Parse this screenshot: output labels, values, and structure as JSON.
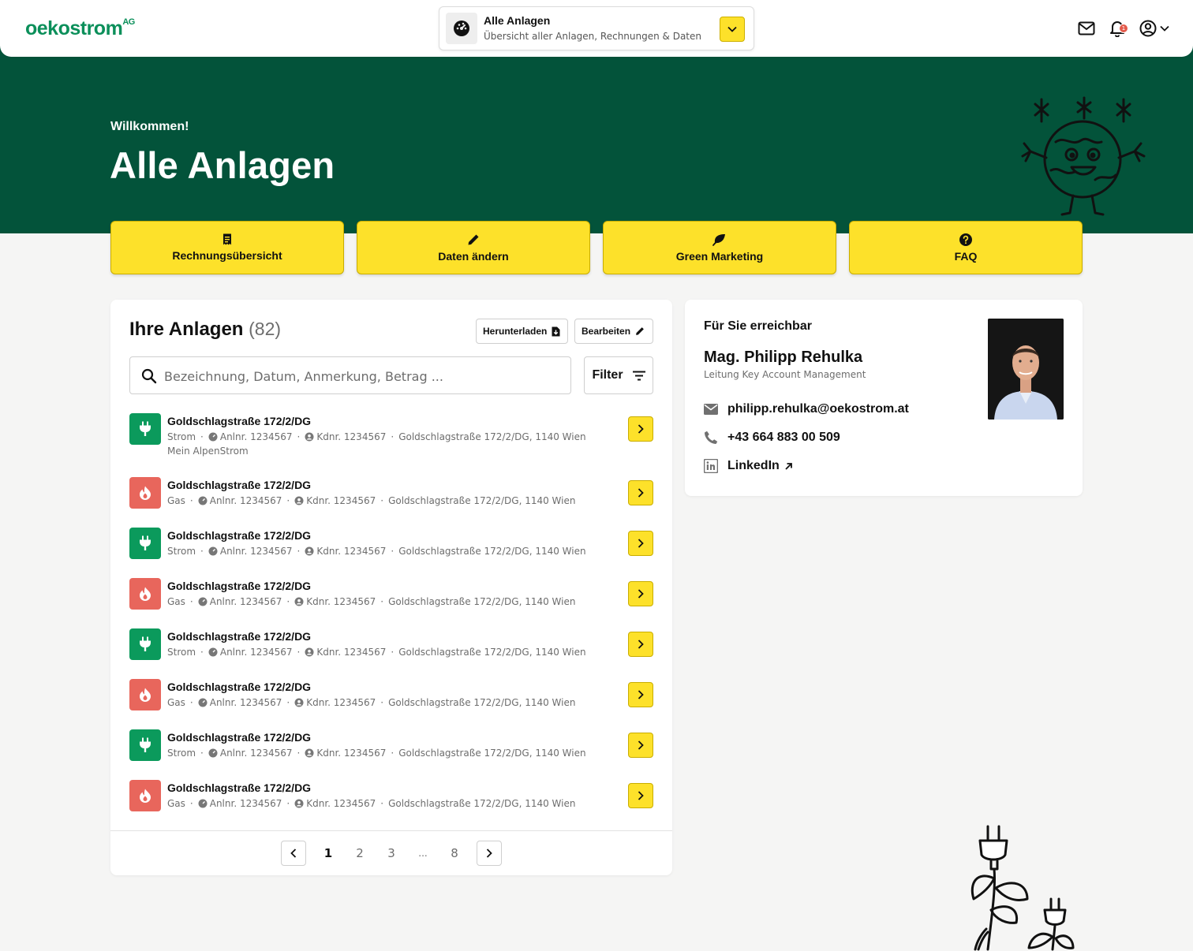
{
  "header": {
    "logo_text": "oekostrom",
    "logo_suffix": "AG",
    "switcher": {
      "title": "Alle Anlagen",
      "subtitle": "Übersicht aller Anlagen, Rechnungen & Daten"
    },
    "notification_count": "1",
    "icons": [
      "mail-icon",
      "bell-icon",
      "user-circle-icon",
      "chevron-down-icon"
    ]
  },
  "hero": {
    "welcome": "Willkommen!",
    "title": "Alle Anlagen"
  },
  "tiles": [
    {
      "label": "Rechnungsübersicht",
      "icon": "receipt-icon"
    },
    {
      "label": "Daten ändern",
      "icon": "pencil-icon"
    },
    {
      "label": "Green Marketing",
      "icon": "leaf-icon"
    },
    {
      "label": "FAQ",
      "icon": "question-icon"
    }
  ],
  "anlagen": {
    "title": "Ihre Anlagen",
    "count": "(82)",
    "download_label": "Herunterladen",
    "edit_label": "Bearbeiten",
    "search_placeholder": "Bezeichnung, Datum, Anmerkung, Betrag ...",
    "filter_label": "Filter",
    "rows": [
      {
        "type": "strom",
        "name": "Goldschlagstraße 172/2/DG",
        "kind": "Strom",
        "anlnr": "Anlnr. 1234567",
        "kdnr": "Kdnr. 1234567",
        "address": "Goldschlagstraße 172/2/DG, 1140 Wien",
        "sub": "Mein AlpenStrom"
      },
      {
        "type": "gas",
        "name": "Goldschlagstraße 172/2/DG",
        "kind": "Gas",
        "anlnr": "Anlnr. 1234567",
        "kdnr": "Kdnr. 1234567",
        "address": "Goldschlagstraße 172/2/DG, 1140 Wien"
      },
      {
        "type": "strom",
        "name": "Goldschlagstraße 172/2/DG",
        "kind": "Strom",
        "anlnr": "Anlnr. 1234567",
        "kdnr": "Kdnr. 1234567",
        "address": "Goldschlagstraße 172/2/DG, 1140 Wien"
      },
      {
        "type": "gas",
        "name": "Goldschlagstraße 172/2/DG",
        "kind": "Gas",
        "anlnr": "Anlnr. 1234567",
        "kdnr": "Kdnr. 1234567",
        "address": "Goldschlagstraße 172/2/DG, 1140 Wien"
      },
      {
        "type": "strom",
        "name": "Goldschlagstraße 172/2/DG",
        "kind": "Strom",
        "anlnr": "Anlnr. 1234567",
        "kdnr": "Kdnr. 1234567",
        "address": "Goldschlagstraße 172/2/DG, 1140 Wien"
      },
      {
        "type": "gas",
        "name": "Goldschlagstraße 172/2/DG",
        "kind": "Gas",
        "anlnr": "Anlnr. 1234567",
        "kdnr": "Kdnr. 1234567",
        "address": "Goldschlagstraße 172/2/DG, 1140 Wien"
      },
      {
        "type": "strom",
        "name": "Goldschlagstraße 172/2/DG",
        "kind": "Strom",
        "anlnr": "Anlnr. 1234567",
        "kdnr": "Kdnr. 1234567",
        "address": "Goldschlagstraße 172/2/DG, 1140 Wien"
      },
      {
        "type": "gas",
        "name": "Goldschlagstraße 172/2/DG",
        "kind": "Gas",
        "anlnr": "Anlnr. 1234567",
        "kdnr": "Kdnr. 1234567",
        "address": "Goldschlagstraße 172/2/DG, 1140 Wien"
      }
    ],
    "pagination": {
      "pages": [
        "1",
        "2",
        "3",
        "...",
        "8"
      ],
      "current": "1"
    }
  },
  "contact": {
    "heading": "Für Sie erreichbar",
    "name": "Mag. Philipp Rehulka",
    "role": "Leitung Key Account Management",
    "email": "philipp.rehulka@oekostrom.at",
    "phone": "+43 664 883 00 509",
    "linkedin": "LinkedIn"
  },
  "colors": {
    "brand_green": "#03533a",
    "accent_yellow": "#fde12a",
    "strom_green": "#0b9a5c",
    "gas_red": "#e8665c",
    "logo_green": "#0b8f5a"
  }
}
